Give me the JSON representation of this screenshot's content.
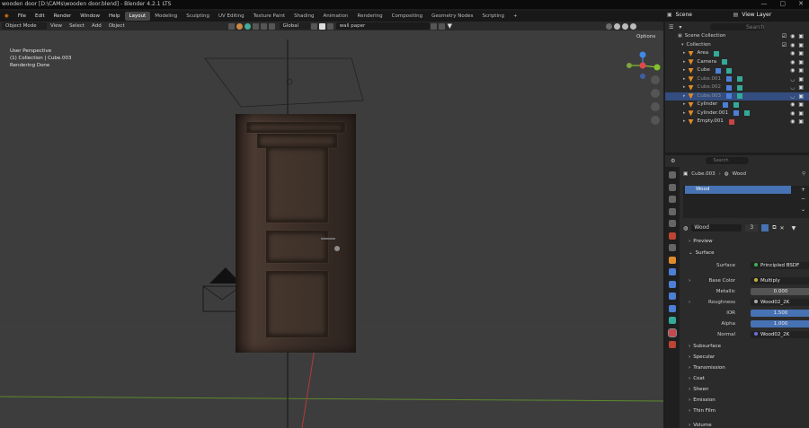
{
  "window": {
    "title": "wooden door [D:\\CAMs\\wooden door.blend] - Blender 4.2.1 LTS",
    "controls": [
      "—",
      "▢",
      "✕"
    ]
  },
  "menu": [
    "File",
    "Edit",
    "Render",
    "Window",
    "Help"
  ],
  "workspaces": [
    "Layout",
    "Modeling",
    "Sculpting",
    "UV Editing",
    "Texture Paint",
    "Shading",
    "Animation",
    "Rendering",
    "Compositing",
    "Geometry Nodes",
    "Scripting",
    "+"
  ],
  "active_workspace": "Layout",
  "scene": {
    "label": "Scene",
    "view_layer": "View Layer"
  },
  "viewport": {
    "mode": "Object Mode",
    "menus": [
      "View",
      "Select",
      "Add",
      "Object"
    ],
    "orientation": "Global",
    "search_value": "wall paper",
    "options_label": "Options",
    "info_line1": "User Perspective",
    "info_line2": "(1) Collection | Cube.003",
    "info_line3": "Rendering Done"
  },
  "outliner": {
    "search_placeholder": "Search",
    "scene_collection": "Scene Collection",
    "collection": "Collection",
    "items": [
      {
        "name": "Area",
        "state": "normal"
      },
      {
        "name": "Camera",
        "state": "normal"
      },
      {
        "name": "Cube",
        "state": "normal"
      },
      {
        "name": "Cube.001",
        "state": "dim"
      },
      {
        "name": "Cube.002",
        "state": "dim"
      },
      {
        "name": "Cube.003",
        "state": "selected"
      },
      {
        "name": "Cylinder",
        "state": "normal"
      },
      {
        "name": "Cylinder.001",
        "state": "normal"
      },
      {
        "name": "Empty.001",
        "state": "normal"
      }
    ]
  },
  "properties": {
    "search_placeholder": "Search",
    "breadcrumb_object": "Cube.003",
    "breadcrumb_material": "Wood",
    "slot_name": "Wood",
    "material_name": "Wood",
    "user_count": "3",
    "sections": {
      "preview": "Preview",
      "surface": "Surface"
    },
    "fields": [
      {
        "label": "Surface",
        "value": "Principled BSDF",
        "kind": "link",
        "dot": "green"
      },
      {
        "label": "Base Color",
        "value": "Multiply",
        "kind": "link",
        "dot": "yellow"
      },
      {
        "label": "Metallic",
        "value": "0.000",
        "kind": "num"
      },
      {
        "label": "Roughness",
        "value": "Wood02_2K",
        "kind": "link",
        "dot": "grey"
      },
      {
        "label": "IOR",
        "value": "1.500",
        "kind": "blue"
      },
      {
        "label": "Alpha",
        "value": "1.000",
        "kind": "blue"
      },
      {
        "label": "Normal",
        "value": "Wood02_2K",
        "kind": "link",
        "dot": "purple"
      }
    ],
    "subsections": [
      "Subsurface",
      "Specular",
      "Transmission",
      "Coat",
      "Sheen",
      "Emission",
      "Thin Film"
    ],
    "volume": "Volume"
  },
  "colors": {
    "accent_blue": "#4772b3",
    "selection": "#334d80",
    "x_axis": "#e0484f",
    "y_axis": "#84c12b",
    "z_axis": "#3e8ae6"
  }
}
